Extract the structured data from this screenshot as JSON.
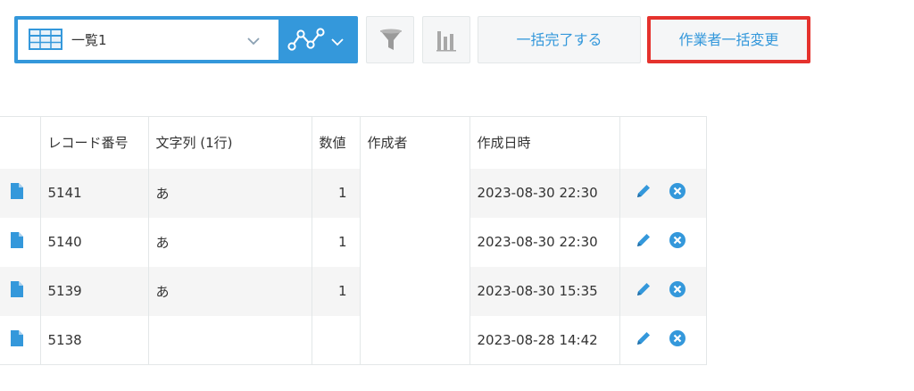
{
  "toolbar": {
    "view_name": "一覧1",
    "bulk_complete_label": "一括完了する",
    "bulk_assignee_label": "作業者一括変更"
  },
  "icons": {
    "view_list": "table-list-icon",
    "view_dropdown": "chevron-down-icon",
    "graph": "line-graph-icon",
    "filter": "funnel-icon",
    "chart": "bar-chart-icon",
    "record": "document-icon",
    "edit": "pencil-icon",
    "delete": "close-circle-icon"
  },
  "colors": {
    "accent": "#3498db",
    "highlight_border": "#e5322d",
    "row_stripe": "#f5f5f5"
  },
  "table": {
    "headers": [
      "レコード番号",
      "文字列 (1行)",
      "数値",
      "作成者",
      "作成日時"
    ],
    "rows": [
      {
        "record_no": "5141",
        "text": "あ",
        "number": "1",
        "creator": "",
        "created_at": "2023-08-30 22:30"
      },
      {
        "record_no": "5140",
        "text": "あ",
        "number": "1",
        "creator": "",
        "created_at": "2023-08-30 22:30"
      },
      {
        "record_no": "5139",
        "text": "あ",
        "number": "1",
        "creator": "",
        "created_at": "2023-08-30 15:35"
      },
      {
        "record_no": "5138",
        "text": "",
        "number": "",
        "creator": "",
        "created_at": "2023-08-28 14:42"
      }
    ]
  }
}
